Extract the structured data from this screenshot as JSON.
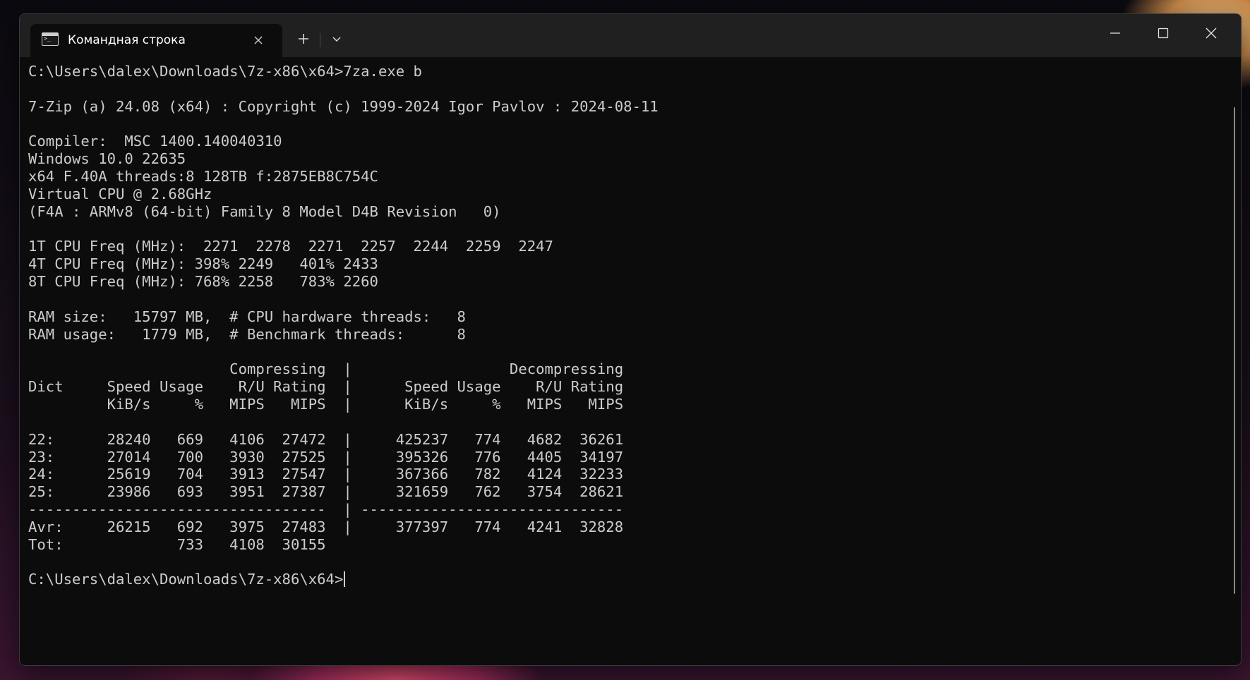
{
  "window": {
    "tab_title": "Командная строка",
    "tab_icon": "terminal-icon",
    "close_tab_icon": "close-icon",
    "new_tab_icon": "plus-icon",
    "dropdown_icon": "chevron-down-icon",
    "controls": [
      "minimize-icon",
      "maximize-icon",
      "close-icon"
    ]
  },
  "terminal": {
    "lines": [
      "C:\\Users\\dalex\\Downloads\\7z-x86\\x64>7za.exe b",
      "",
      "7-Zip (a) 24.08 (x64) : Copyright (c) 1999-2024 Igor Pavlov : 2024-08-11",
      "",
      "Compiler:  MSC 1400.140040310",
      "Windows 10.0 22635",
      "x64 F.40A threads:8 128TB f:2875EB8C754C",
      "Virtual CPU @ 2.68GHz",
      "(F4A : ARMv8 (64-bit) Family 8 Model D4B Revision   0)",
      "",
      "1T CPU Freq (MHz):  2271  2278  2271  2257  2244  2259  2247",
      "4T CPU Freq (MHz): 398% 2249   401% 2433",
      "8T CPU Freq (MHz): 768% 2258   783% 2260",
      "",
      "RAM size:   15797 MB,  # CPU hardware threads:   8",
      "RAM usage:   1779 MB,  # Benchmark threads:      8",
      "",
      "                       Compressing  |                  Decompressing",
      "Dict     Speed Usage    R/U Rating  |      Speed Usage    R/U Rating",
      "         KiB/s     %   MIPS   MIPS  |      KiB/s     %   MIPS   MIPS",
      "",
      "22:      28240   669   4106  27472  |     425237   774   4682  36261",
      "23:      27014   700   3930  27525  |     395326   776   4405  34197",
      "24:      25619   704   3913  27547  |     367366   782   4124  32233",
      "25:      23986   693   3951  27387  |     321659   762   3754  28621",
      "----------------------------------  | ------------------------------",
      "Avr:     26215   692   3975  27483  |     377397   774   4241  32828",
      "Tot:             733   4108  30155",
      ""
    ],
    "prompt": "C:\\Users\\dalex\\Downloads\\7z-x86\\x64>"
  }
}
